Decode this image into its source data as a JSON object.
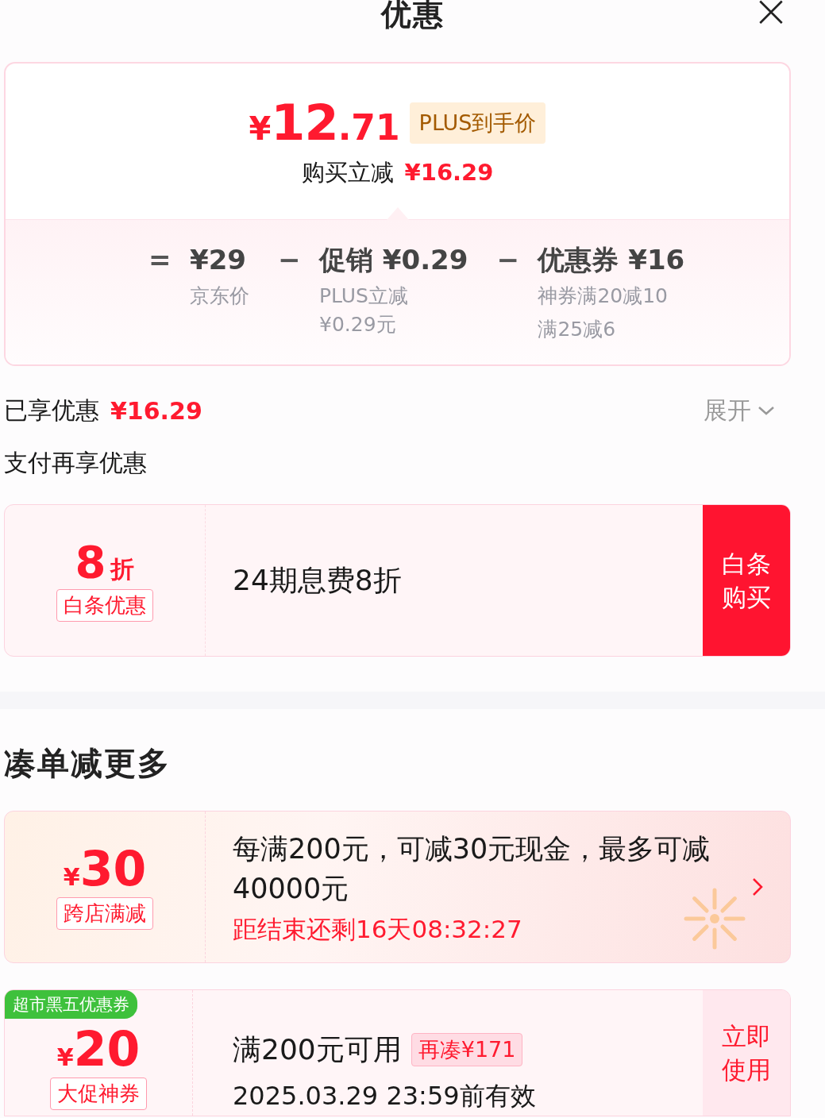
{
  "title": "优惠",
  "summary": {
    "currency": "¥",
    "price_integer": "12",
    "price_decimal": ".71",
    "badge": "PLUS到手价",
    "reduction_label": "购买立减",
    "reduction_amount": "¥16.29",
    "breakdown": [
      {
        "operator": "=",
        "amount": "¥29",
        "notes": [
          "京东价"
        ]
      },
      {
        "operator": "−",
        "amount": "促销 ¥0.29",
        "notes": [
          "PLUS立减 ¥0.29元"
        ]
      },
      {
        "operator": "−",
        "amount": "优惠券 ¥16",
        "notes": [
          "神券满20减10",
          "满25减6"
        ]
      }
    ]
  },
  "enjoyed": {
    "label": "已享优惠",
    "amount": "¥16.29",
    "toggle": "展开"
  },
  "payment_section": {
    "title": "支付再享优惠",
    "offer": {
      "value": "8",
      "unit": "折",
      "tag": "白条优惠",
      "description": "24期息费8折",
      "button": "白条购买"
    }
  },
  "bundle_section": {
    "title": "凑单减更多",
    "coupons": [
      {
        "kind": "promo",
        "currency": "¥",
        "value": "30",
        "tag": "跨店满减",
        "description": "每满200元，可减30元现金，最多可减40000元",
        "countdown": "距结束还剩16天08:32:27"
      },
      {
        "kind": "coupon",
        "ribbon": "超市黑五优惠券",
        "currency": "¥",
        "value": "20",
        "tag": "大促神券",
        "condition": "满200元可用",
        "hint": "再凑¥171",
        "validity": "2025.03.29 23:59前有效",
        "button": "立即使用"
      }
    ]
  }
}
